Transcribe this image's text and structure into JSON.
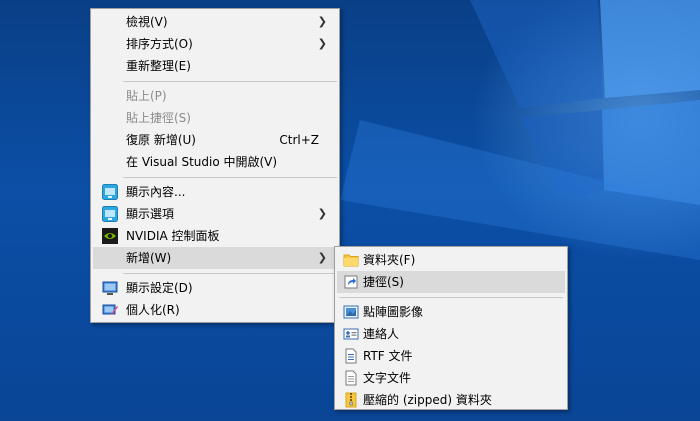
{
  "colors": {
    "desktop_bg": "#0b4fa6",
    "menu_bg": "#f2f2f2",
    "hover_bg": "#dadada",
    "disabled_text": "#8b8b8b"
  },
  "context_menu": {
    "view": "檢視(V)",
    "sort_by": "排序方式(O)",
    "refresh": "重新整理(E)",
    "paste": "貼上(P)",
    "paste_shortcut": "貼上捷徑(S)",
    "undo_new": "復原 新增(U)",
    "undo_new_shortcut": "Ctrl+Z",
    "open_in_vs": "在 Visual Studio 中開啟(V)",
    "display_content": "顯示內容...",
    "display_options": "顯示選項",
    "nvidia": "NVIDIA 控制面板",
    "new": "新增(W)",
    "display_settings": "顯示設定(D)",
    "personalize": "個人化(R)"
  },
  "new_submenu": {
    "folder": "資料夾(F)",
    "shortcut": "捷徑(S)",
    "bitmap": "點陣圖影像",
    "contact": "連絡人",
    "rtf": "RTF 文件",
    "text": "文字文件",
    "zip": "壓縮的 (zipped) 資料夾"
  }
}
